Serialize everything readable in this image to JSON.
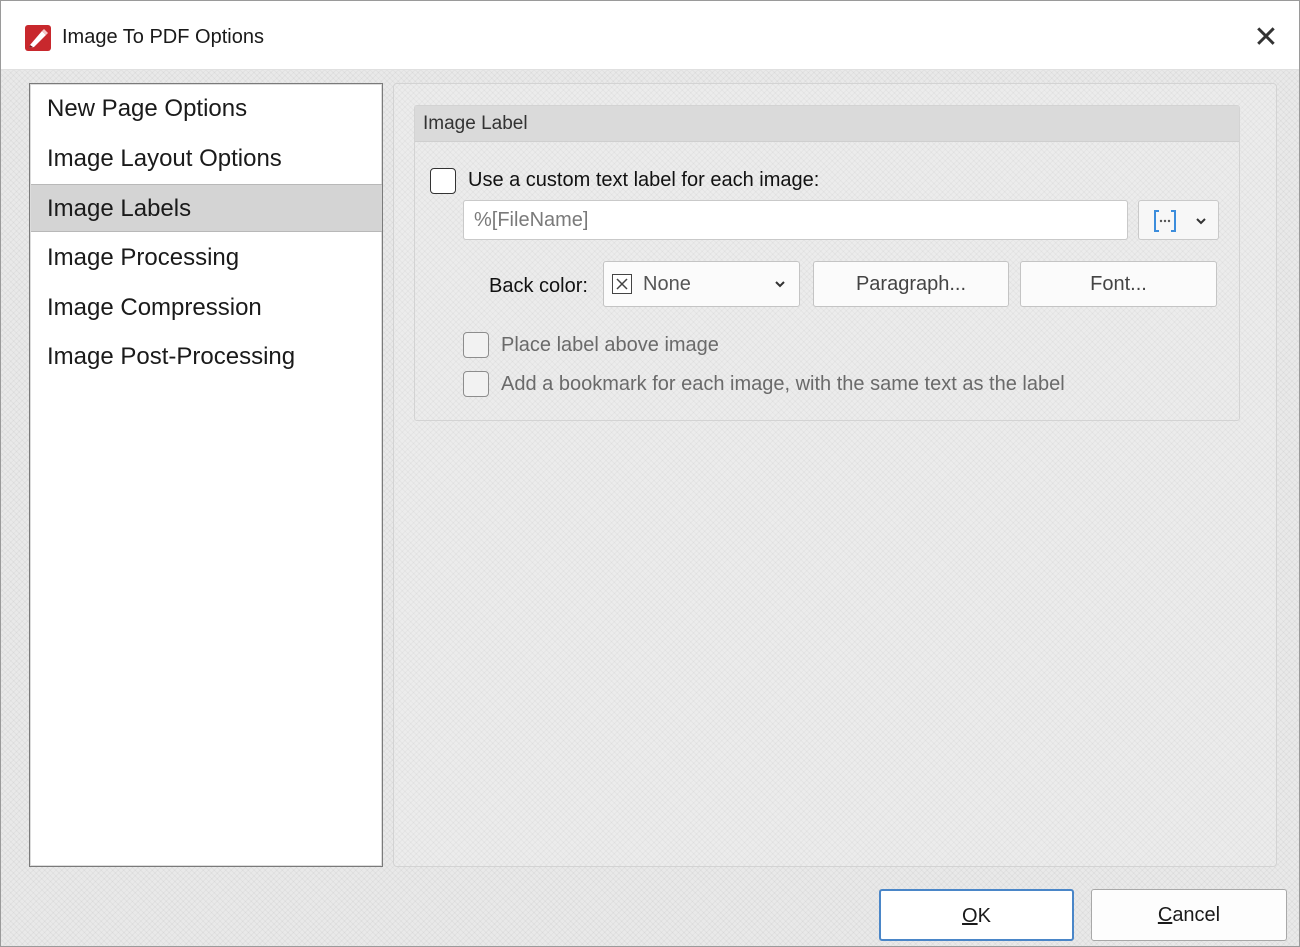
{
  "window": {
    "title": "Image To PDF Options",
    "close_symbol": "✕"
  },
  "sidebar": {
    "items": [
      {
        "label": "New Page Options",
        "selected": false
      },
      {
        "label": "Image Layout Options",
        "selected": false
      },
      {
        "label": "Image Labels",
        "selected": true
      },
      {
        "label": "Image Processing",
        "selected": false
      },
      {
        "label": "Image Compression",
        "selected": false
      },
      {
        "label": "Image Post-Processing",
        "selected": false
      }
    ]
  },
  "image_label": {
    "group_title": "Image Label",
    "use_custom_label": {
      "label": "Use a custom text label for each image:",
      "checked": false
    },
    "label_text": {
      "value": "%[FileName]"
    },
    "back_color": {
      "label": "Back color:",
      "value": "None"
    },
    "paragraph_button": "Paragraph...",
    "font_button": "Font...",
    "place_above": {
      "label": "Place label above image",
      "checked": false
    },
    "add_bookmark": {
      "label": "Add a bookmark for each image, with the same text as the label",
      "checked": false
    }
  },
  "footer": {
    "ok_mnemonic": "O",
    "ok_rest": "K",
    "cancel_mnemonic": "C",
    "cancel_rest": "ancel"
  },
  "colors": {
    "accent_border": "#4a86c8",
    "app_icon_red": "#c8282d",
    "macro_icon_blue": "#3c8ddc"
  }
}
